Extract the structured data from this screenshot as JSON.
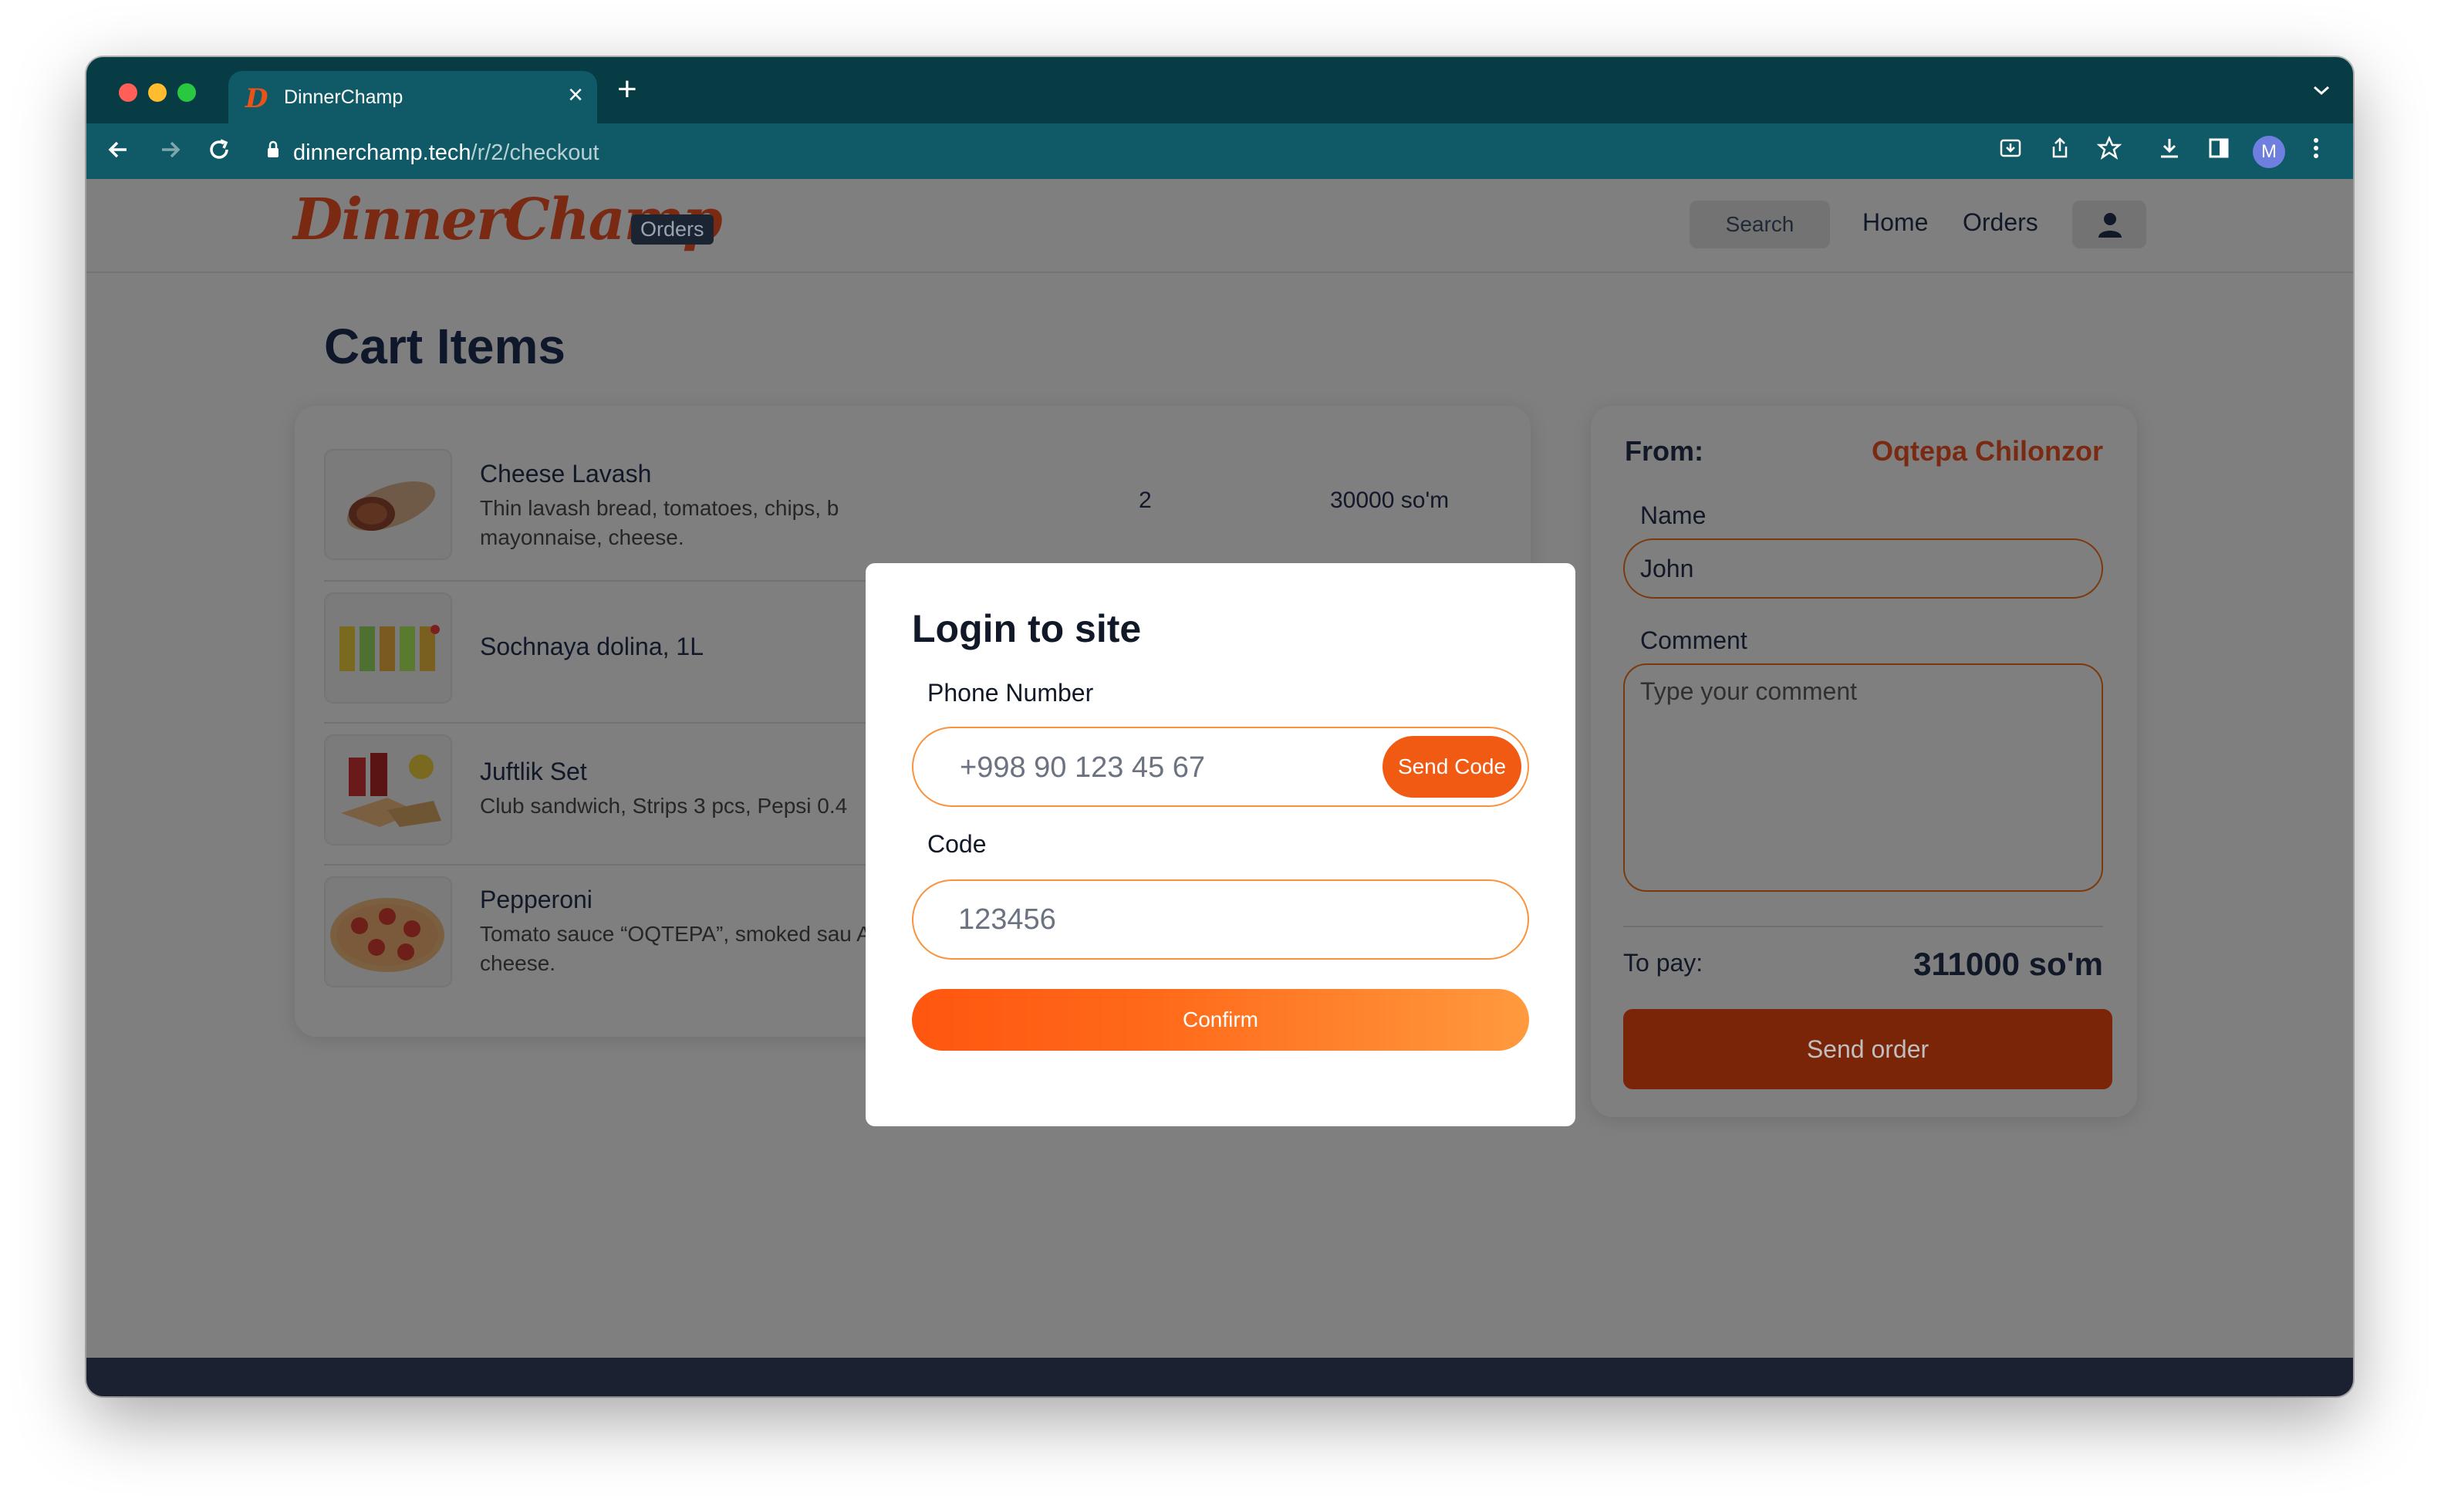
{
  "browser": {
    "tab_title": "DinnerChamp",
    "tab_favicon": "D",
    "tab_close": "×",
    "new_tab": "+",
    "tab_menu": "⌄",
    "url_host": "dinnerchamp.tech",
    "url_path": "/r/2/checkout",
    "profile_initial": "M"
  },
  "header": {
    "logo_text": "DinnerChamp",
    "logo_badge": "Orders",
    "search_label": "Search",
    "nav_home": "Home",
    "nav_orders": "Orders"
  },
  "cart": {
    "title": "Cart Items",
    "items": [
      {
        "name": "Cheese Lavash",
        "description": "Thin lavash bread, tomatoes, chips, b mayonnaise, cheese.",
        "quantity": "2",
        "price": "30000 so'm"
      },
      {
        "name": "Sochnaya dolina, 1L",
        "description": ""
      },
      {
        "name": "Juftlik Set",
        "description": "Club sandwich, Strips 3 pcs, Pepsi 0.4"
      },
      {
        "name": "Pepperoni",
        "description": "Tomato sauce “OQTEPA”, smoked sau Akbel cheese."
      }
    ]
  },
  "order": {
    "from_label": "From:",
    "from_value": "Oqtepa Chilonzor",
    "name_label": "Name",
    "name_value": "John",
    "comment_label": "Comment",
    "comment_placeholder": "Type your comment",
    "to_pay_label": "To pay:",
    "to_pay_value": "311000 so'm",
    "send_order_label": "Send order"
  },
  "modal": {
    "title": "Login to site",
    "phone_label": "Phone Number",
    "phone_placeholder": "+998 90 123 45 67",
    "send_code_label": "Send Code",
    "code_label": "Code",
    "code_placeholder": "123456",
    "confirm_label": "Confirm"
  },
  "colors": {
    "brand": "#e8531a",
    "chrome": "#0f5a66",
    "overlay": "#7f7f7f",
    "accent_orange": "#fb923c",
    "send_order": "#7a2508"
  }
}
